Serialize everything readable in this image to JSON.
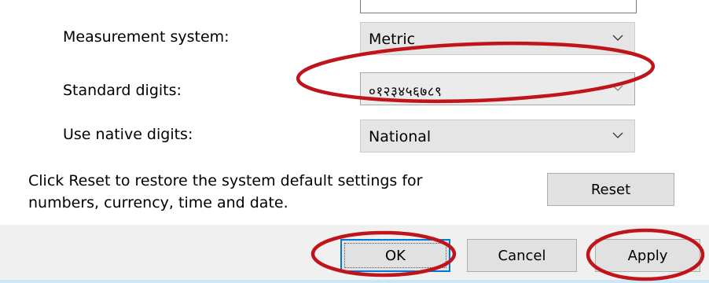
{
  "top_cut_label": "...",
  "rows": [
    {
      "label": "Measurement system:",
      "value": "Metric"
    },
    {
      "label": "Standard digits:",
      "value": "०१२३४५६७८९"
    },
    {
      "label": "Use native digits:",
      "value": "National"
    }
  ],
  "reset_text": {
    "line1": "Click Reset to restore the system default settings for",
    "line2": "numbers, currency, time and date."
  },
  "buttons": {
    "reset": "Reset",
    "ok": "OK",
    "cancel": "Cancel",
    "apply": "Apply"
  },
  "icons": {
    "dropdown": "chevron-down-icon"
  },
  "colors": {
    "annotation": "#c0141b",
    "focus_border": "#0078d7",
    "footer_background": "#f0f0f0"
  }
}
